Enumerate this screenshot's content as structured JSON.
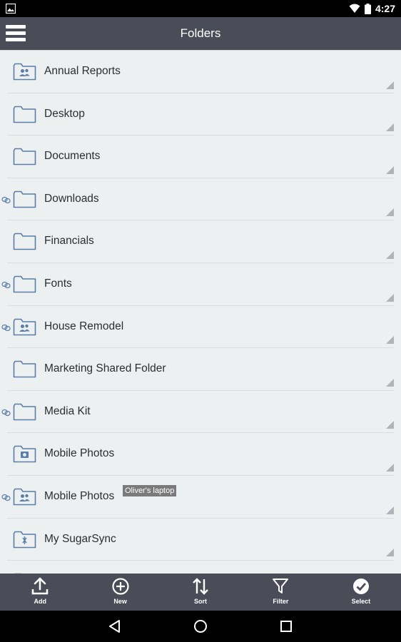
{
  "status_bar": {
    "time": "4:27",
    "icons": [
      "image-notification-icon",
      "wifi-icon",
      "battery-icon"
    ]
  },
  "app_bar": {
    "title": "Folders",
    "menu_icon": "hamburger-menu-icon"
  },
  "folders": [
    {
      "name": "Annual Reports",
      "type": "shared",
      "linked": false,
      "badge": ""
    },
    {
      "name": "Desktop",
      "type": "plain",
      "linked": false,
      "badge": ""
    },
    {
      "name": "Documents",
      "type": "plain",
      "linked": false,
      "badge": ""
    },
    {
      "name": "Downloads",
      "type": "plain",
      "linked": true,
      "badge": ""
    },
    {
      "name": "Financials",
      "type": "plain",
      "linked": false,
      "badge": ""
    },
    {
      "name": "Fonts",
      "type": "plain",
      "linked": true,
      "badge": ""
    },
    {
      "name": "House Remodel",
      "type": "shared",
      "linked": true,
      "badge": ""
    },
    {
      "name": "Marketing Shared Folder",
      "type": "plain",
      "linked": false,
      "badge": ""
    },
    {
      "name": "Media Kit",
      "type": "plain",
      "linked": true,
      "badge": ""
    },
    {
      "name": "Mobile Photos",
      "type": "camera",
      "linked": false,
      "badge": ""
    },
    {
      "name": "Mobile Photos",
      "type": "shared",
      "linked": true,
      "badge": "Oliver's laptop"
    },
    {
      "name": "My SugarSync",
      "type": "sugarsync",
      "linked": false,
      "badge": ""
    },
    {
      "name": "",
      "type": "plain",
      "linked": false,
      "badge": ""
    }
  ],
  "toolbar": {
    "add_label": "Add",
    "new_label": "New",
    "sort_label": "Sort",
    "filter_label": "Filter",
    "select_label": "Select"
  },
  "nav": {
    "icons": [
      "back-icon",
      "home-icon",
      "recents-icon"
    ]
  },
  "colors": {
    "app_bar": "#4a4d57",
    "list_background": "#ecf0f1",
    "folder_stroke": "#5a7ea8",
    "badge_background": "#7a7a7a"
  }
}
